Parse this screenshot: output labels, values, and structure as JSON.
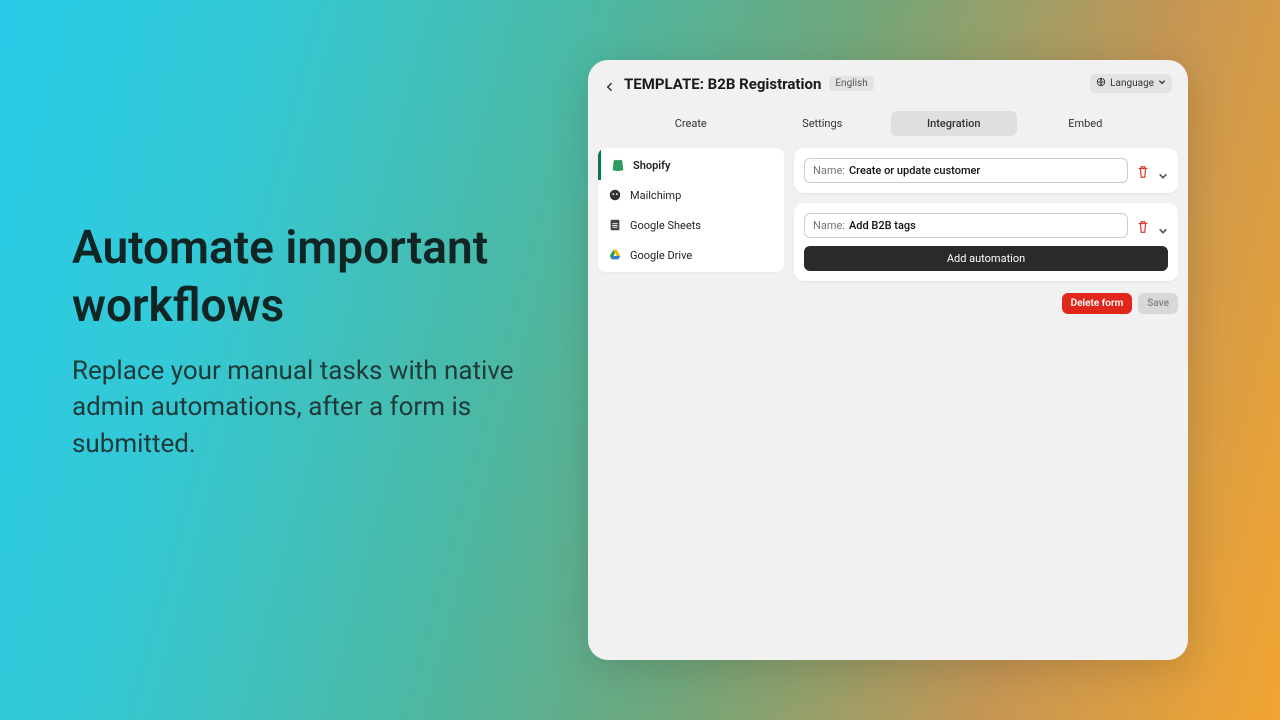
{
  "marketing": {
    "headline": "Automate important workflows",
    "sub": "Replace your manual tasks with native admin automations, after a form is submitted."
  },
  "header": {
    "title": "TEMPLATE: B2B Registration",
    "badge": "English",
    "lang_selector": "Language"
  },
  "tabs": {
    "create": "Create",
    "settings": "Settings",
    "integration": "Integration",
    "embed": "Embed"
  },
  "sidebar": {
    "items": [
      {
        "label": "Shopify"
      },
      {
        "label": "Mailchimp"
      },
      {
        "label": "Google Sheets"
      },
      {
        "label": "Google Drive"
      }
    ]
  },
  "automations": {
    "name_label": "Name:",
    "rows": [
      {
        "value": "Create or update customer"
      },
      {
        "value": "Add B2B tags"
      }
    ],
    "add_label": "Add automation"
  },
  "footer": {
    "delete": "Delete form",
    "save": "Save"
  }
}
